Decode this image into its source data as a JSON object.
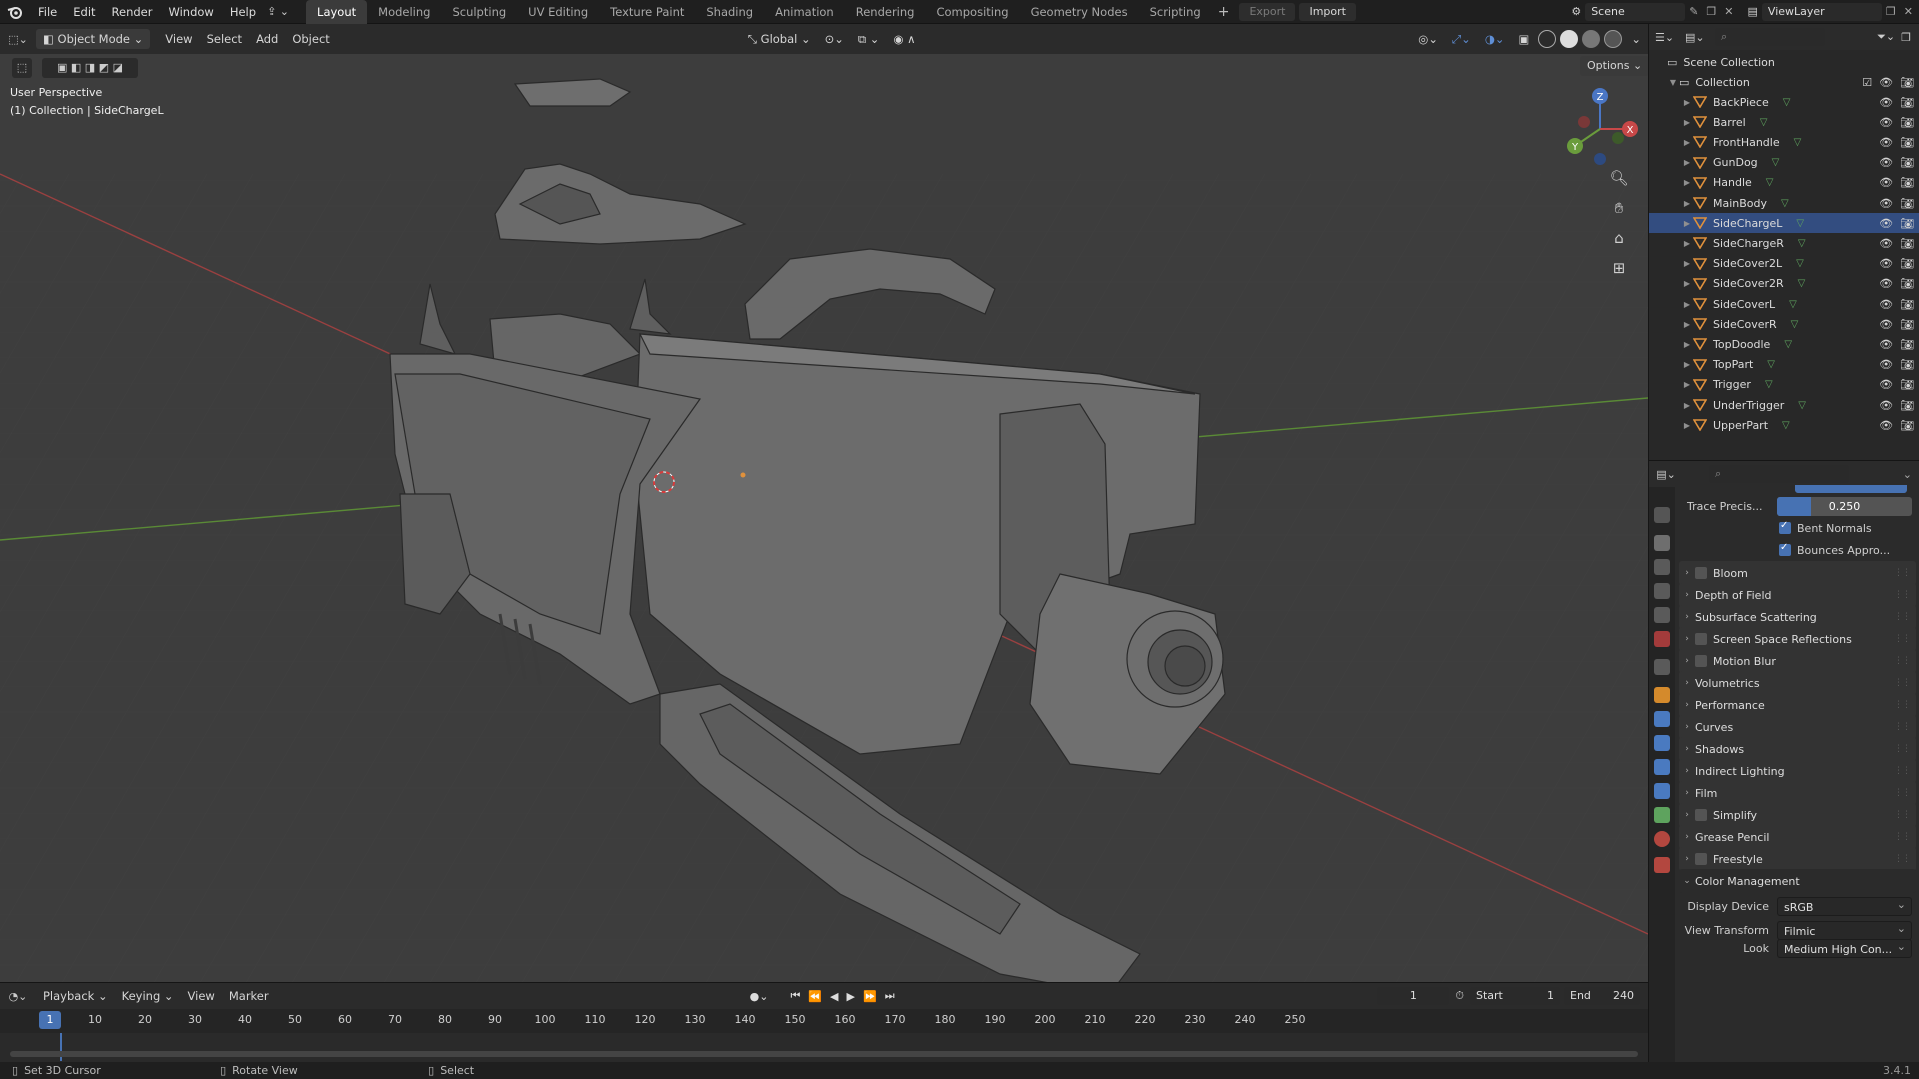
{
  "menubar": {
    "items": [
      "File",
      "Edit",
      "Render",
      "Window",
      "Help"
    ],
    "workspaces": [
      "Layout",
      "Modeling",
      "Sculpting",
      "UV Editing",
      "Texture Paint",
      "Shading",
      "Animation",
      "Rendering",
      "Compositing",
      "Geometry Nodes",
      "Scripting"
    ],
    "active_workspace": "Layout",
    "export_label": "Export",
    "import_label": "Import",
    "scene": "Scene",
    "view_layer": "ViewLayer"
  },
  "viewport_header": {
    "mode": "Object Mode",
    "menus": [
      "View",
      "Select",
      "Add",
      "Object"
    ],
    "orientation": "Global",
    "options": "Options"
  },
  "viewport": {
    "perspective_label": "User Perspective",
    "collection_label": "(1) Collection | SideChargeL",
    "gizmo_axes": [
      "X",
      "Y",
      "Z"
    ]
  },
  "outliner": {
    "root": "Scene Collection",
    "collection": "Collection",
    "objects": [
      "BackPiece",
      "Barrel",
      "FrontHandle",
      "GunDog",
      "Handle",
      "MainBody",
      "SideChargeL",
      "SideChargeR",
      "SideCover2L",
      "SideCover2R",
      "SideCoverL",
      "SideCoverR",
      "TopDoodle",
      "TopPart",
      "Trigger",
      "UnderTrigger",
      "UpperPart"
    ],
    "selected": "SideChargeL"
  },
  "properties": {
    "trace_precision_label": "Trace Precis...",
    "trace_precision_value": "0.250",
    "bent_normals": "Bent Normals",
    "bounces_approx": "Bounces Appro...",
    "panels": [
      {
        "label": "Bloom",
        "checkbox": true
      },
      {
        "label": "Depth of Field",
        "checkbox": false
      },
      {
        "label": "Subsurface Scattering",
        "checkbox": false
      },
      {
        "label": "Screen Space Reflections",
        "checkbox": true
      },
      {
        "label": "Motion Blur",
        "checkbox": true
      },
      {
        "label": "Volumetrics",
        "checkbox": false
      },
      {
        "label": "Performance",
        "checkbox": false
      },
      {
        "label": "Curves",
        "checkbox": false
      },
      {
        "label": "Shadows",
        "checkbox": false
      },
      {
        "label": "Indirect Lighting",
        "checkbox": false
      },
      {
        "label": "Film",
        "checkbox": false
      },
      {
        "label": "Simplify",
        "checkbox": true
      },
      {
        "label": "Grease Pencil",
        "checkbox": false
      },
      {
        "label": "Freestyle",
        "checkbox": true
      }
    ],
    "color_management": "Color Management",
    "display_device_label": "Display Device",
    "display_device_value": "sRGB",
    "view_transform_label": "View Transform",
    "view_transform_value": "Filmic",
    "look_label": "Look",
    "look_value": "Medium High Con..."
  },
  "timeline": {
    "menus": [
      "Playback",
      "Keying",
      "View",
      "Marker"
    ],
    "current_frame": "1",
    "start_label": "Start",
    "start_value": "1",
    "end_label": "End",
    "end_value": "240",
    "ticks": [
      "1",
      "10",
      "20",
      "30",
      "40",
      "50",
      "60",
      "70",
      "80",
      "90",
      "100",
      "110",
      "120",
      "130",
      "140",
      "150",
      "160",
      "170",
      "180",
      "190",
      "200",
      "210",
      "220",
      "230",
      "240",
      "250"
    ]
  },
  "statusbar": {
    "left": "Set 3D Cursor",
    "middle": "Rotate View",
    "right": "Select",
    "version": "3.4.1"
  },
  "colors": {
    "accent": "#4772b3",
    "selected_row": "#334d80",
    "mesh_icon": "#e0913c",
    "viewport_bg": "#3d3d3d"
  }
}
